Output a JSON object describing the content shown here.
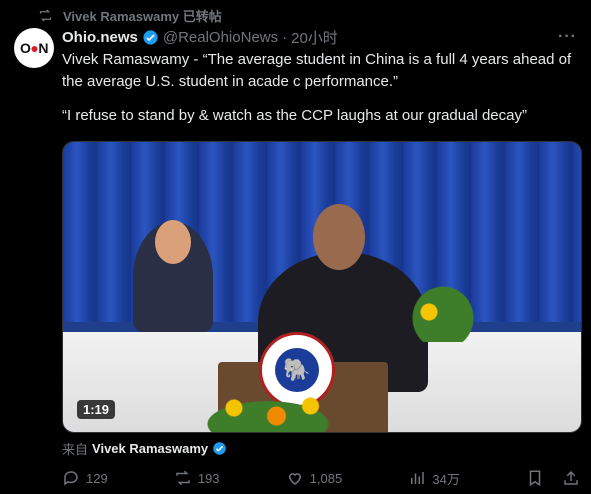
{
  "repost": {
    "icon": "repost-icon",
    "text": "Vivek Ramaswamy 已转帖"
  },
  "author": {
    "avatar_text_left": "O",
    "avatar_text_mid": "N",
    "name": "Ohio.news",
    "handle": "@RealOhioNews",
    "separator": "·",
    "time": "20小时"
  },
  "tweet": {
    "paragraph1": "Vivek Ramaswamy - “The average student in China is a full 4 years ahead of the average U.S. student in acade    c performance.”",
    "paragraph2": "“I refuse to stand by & watch as the CCP laughs at our gradual decay”"
  },
  "media": {
    "duration": "1:19"
  },
  "attribution": {
    "prefix": "来自",
    "name": "Vivek Ramaswamy"
  },
  "actions": {
    "replies": "129",
    "reposts": "193",
    "likes": "1,085",
    "views": "34万"
  },
  "colors": {
    "accent": "#1d9bf0",
    "muted": "#71767b",
    "background": "#000000"
  }
}
